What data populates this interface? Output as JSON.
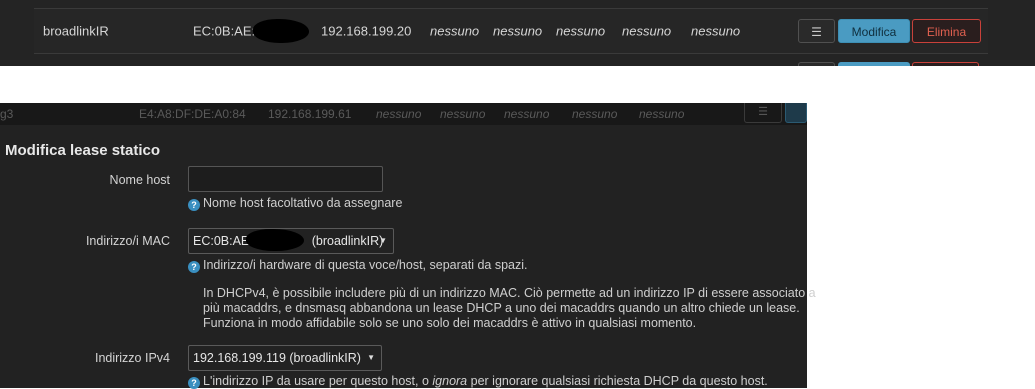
{
  "top_row": {
    "hostname": "broadlinkIR",
    "mac": "EC:0B:AE:",
    "ip": "192.168.199.20",
    "duid": "nessuno",
    "tag": "nessuno",
    "lease": "nessuno",
    "ipv6": "nessuno",
    "extra": "nessuno",
    "menu_label": "☰",
    "edit_label": "Modifica",
    "delete_label": "Elimina"
  },
  "faded_row": {
    "hostname": "g3",
    "mac": "E4:A8:DF:DE:A0:84",
    "ip": "192.168.199.61",
    "c1": "nessuno",
    "c2": "nessuno",
    "c3": "nessuno",
    "c4": "nessuno",
    "c5": "nessuno",
    "menu_label": "☰"
  },
  "modal": {
    "title": "Modifica lease statico",
    "hostname": {
      "label": "Nome host",
      "value": "",
      "help": "Nome host facoltativo da assegnare"
    },
    "mac": {
      "label": "Indirizzo/i MAC",
      "value_prefix": "EC:0B:AE:",
      "value_suffix": "(broadlinkIR)",
      "help": "Indirizzo/i hardware di questa voce/host, separati da spazi.",
      "para1": "In DHCPv4, è possibile includere più di un indirizzo MAC. Ciò permette ad un indirizzo IP di essere associato a",
      "para2": "più macaddrs, e dnsmasq abbandona un lease DHCP a uno dei macaddrs quando un altro chiede un lease.",
      "para3": "Funziona in modo affidabile solo se uno solo dei macaddrs è attivo in qualsiasi momento."
    },
    "ipv4": {
      "label": "Indirizzo IPv4",
      "value": "192.168.199.119 (broadlinkIR)",
      "help_before": "L'indirizzo IP da usare per questo host, o",
      "help_em": "ignora",
      "help_after": "per ignorare qualsiasi richiesta DHCP da questo host."
    }
  },
  "icons": {
    "help": "?",
    "caret": "▼"
  },
  "colors": {
    "accent": "#4a9bc2",
    "danger": "#e06050",
    "help_icon": "#3a8fc0"
  }
}
